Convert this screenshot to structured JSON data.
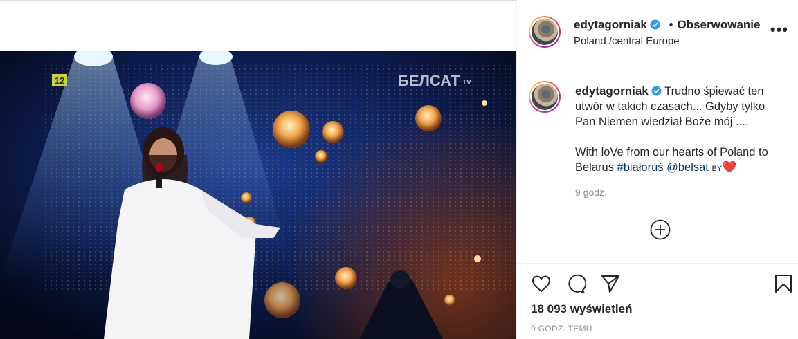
{
  "post": {
    "username": "edytagorniak",
    "follow_separator": "•",
    "follow_label": "Obserwowanie",
    "location": "Poland /central Europe",
    "more_label": "•••",
    "caption_part1": "Trudno śpiewać ten utwór w takich czasach... Gdyby tylko Pan Niemen wiedział Boże mój ....",
    "caption_part2": "With loVe from our hearts of Poland to Belarus",
    "hashtag": "#białoruś",
    "mention": "@belsat",
    "flag_text": "BY",
    "emoji": "❤️",
    "caption_time": "9 godz.",
    "views": "18 093 wyświetleń",
    "posted_ago": "9 GODZ. TEMU"
  },
  "video": {
    "channel_logo": "БЕЛСАТ",
    "channel_logo_sup": "TV",
    "age_rating": "12"
  },
  "icons": {
    "verified": "verified-badge-icon",
    "like": "heart-icon",
    "comment": "comment-icon",
    "share": "paper-plane-icon",
    "save": "bookmark-icon",
    "add_comment": "plus-circle-icon"
  },
  "colors": {
    "link": "#00376b",
    "verified": "#3897f0",
    "muted": "#8e8e8e"
  }
}
